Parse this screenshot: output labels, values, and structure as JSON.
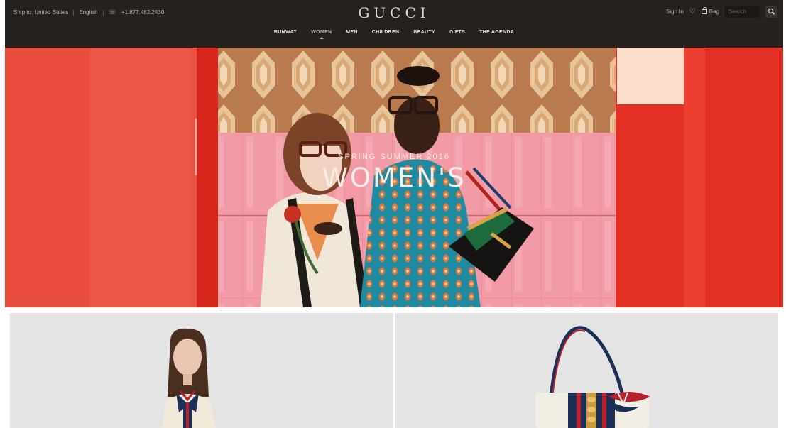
{
  "header": {
    "ship_to": "Ship to: United States",
    "language": "English",
    "phone": "+1.877.482.2430",
    "logo": "GUCCI",
    "sign_in": "Sign In",
    "bag": "Bag",
    "search_placeholder": "Search"
  },
  "nav": {
    "items": [
      {
        "label": "RUNWAY"
      },
      {
        "label": "WOMEN"
      },
      {
        "label": "MEN"
      },
      {
        "label": "CHILDREN"
      },
      {
        "label": "BEAUTY"
      },
      {
        "label": "GIFTS"
      },
      {
        "label": "THE AGENDA"
      }
    ],
    "active": "WOMEN"
  },
  "hero": {
    "subtitle": "SPRING SUMMER 2016",
    "title": "WOMEN'S"
  },
  "icons": {
    "phone": "phone-icon",
    "heart": "heart-icon",
    "bag": "bag-icon",
    "search": "search-icon"
  },
  "colors": {
    "header_bg": "#25211f",
    "hero_red": "#e43a2a",
    "tile_bg": "#e4e4e4"
  }
}
